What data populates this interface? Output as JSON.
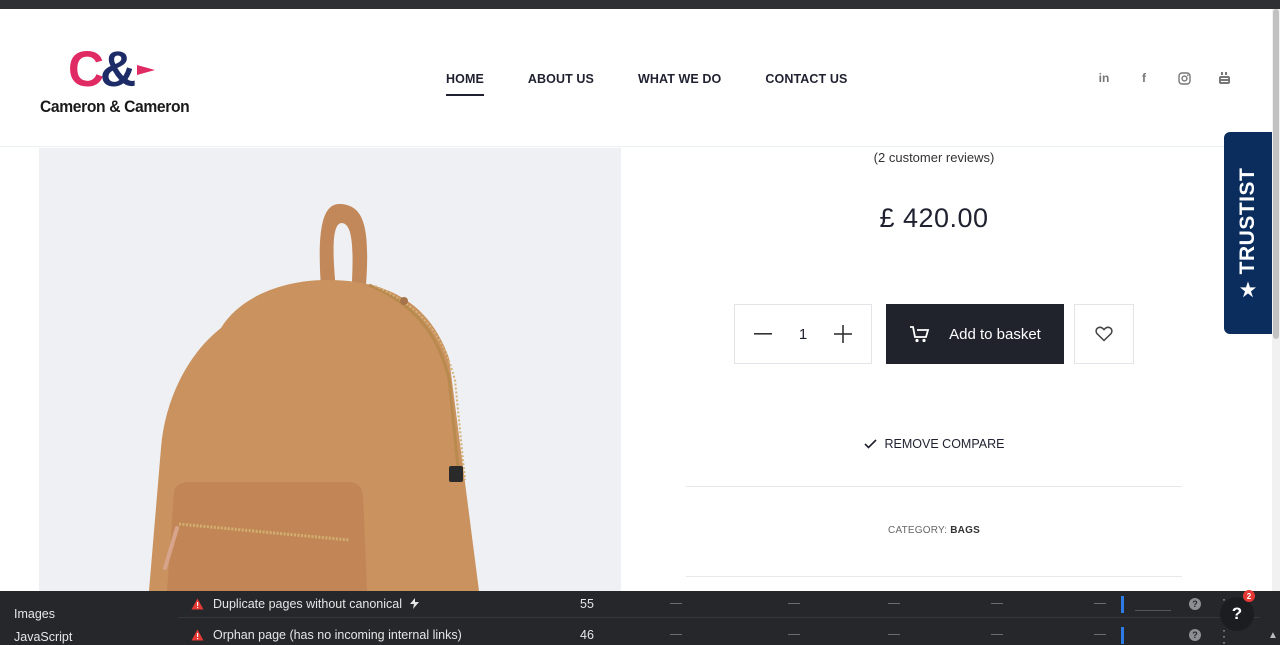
{
  "brand": {
    "mark_c": "C",
    "mark_amp": "&",
    "name": "Cameron & Cameron"
  },
  "nav": {
    "items": [
      {
        "label": "HOME",
        "active": true
      },
      {
        "label": "ABOUT US",
        "active": false
      },
      {
        "label": "WHAT WE DO",
        "active": false
      },
      {
        "label": "CONTACT US",
        "active": false
      }
    ]
  },
  "social": {
    "icons": [
      "linkedin-icon",
      "facebook-icon",
      "instagram-icon",
      "youtube-icon"
    ],
    "linkedin_glyph": "in",
    "facebook_glyph": "f"
  },
  "product": {
    "reviews": "(2 customer reviews)",
    "price": "£ 420.00",
    "quantity": "1",
    "add_to_basket": "Add to basket",
    "remove_compare": "REMOVE COMPARE",
    "category_label": "CATEGORY:",
    "category_value": "BAGS",
    "image_color": "#c8915f"
  },
  "trustist": {
    "label": "TRUSTIST",
    "color": "#0a2d5e"
  },
  "devtools": {
    "sidebar": [
      "Images",
      "JavaScript"
    ],
    "rows": [
      {
        "label": "Duplicate pages without canonical",
        "count": "55",
        "icon": "warning-icon",
        "extra": "lightning-icon"
      },
      {
        "label": "Orphan page (has no incoming internal links)",
        "count": "46",
        "icon": "warning-icon"
      }
    ],
    "help_label": "?",
    "help_badge": "2"
  }
}
